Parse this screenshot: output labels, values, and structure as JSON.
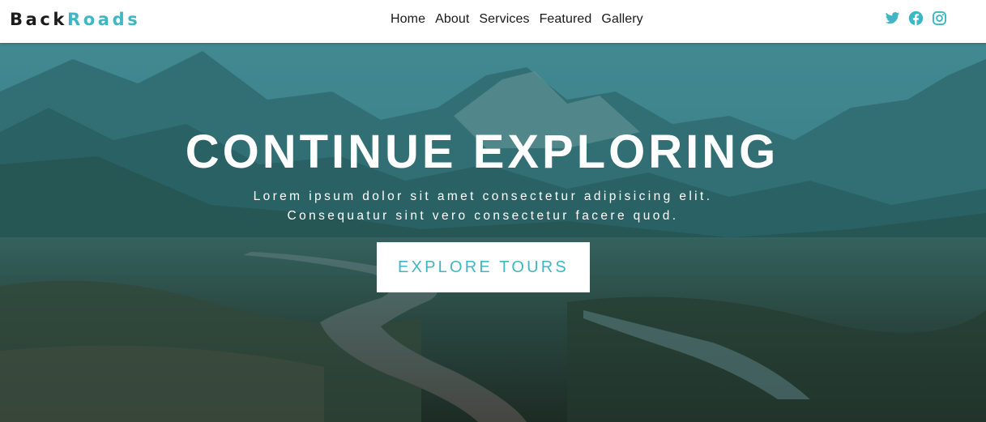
{
  "brand": {
    "part1": "Back",
    "part2": "Roads"
  },
  "nav": {
    "links": [
      {
        "label": "Home"
      },
      {
        "label": "About"
      },
      {
        "label": "Services"
      },
      {
        "label": "Featured"
      },
      {
        "label": "Gallery"
      }
    ]
  },
  "social": {
    "icons": [
      "twitter-icon",
      "facebook-icon",
      "instagram-icon"
    ]
  },
  "hero": {
    "title": "CONTINUE EXPLORING",
    "text_line1": "Lorem ipsum dolor sit amet consectetur adipisicing elit.",
    "text_line2": "Consequatur sint vero consectetur facere quod.",
    "button_label": "EXPLORE TOURS"
  },
  "colors": {
    "accent": "#3fb6c4",
    "dark": "#1c1c1c",
    "overlay": "#2a8f9a"
  }
}
